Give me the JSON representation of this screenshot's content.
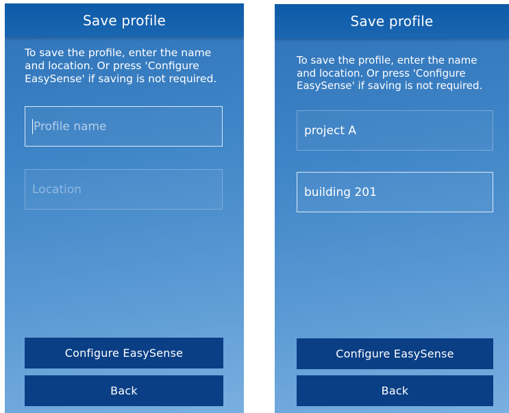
{
  "screens": [
    {
      "title": "Save profile",
      "instructions": "To save the profile, enter the name\nand location. Or press 'Configure\nEasySense' if saving is not required.",
      "profile_name": {
        "value": "",
        "placeholder": "Profile name"
      },
      "location": {
        "value": "",
        "placeholder": "Location"
      },
      "configure_label": "Configure EasySense",
      "back_label": "Back"
    },
    {
      "title": "Save profile",
      "instructions": "To save the profile, enter the name\nand location. Or press 'Configure\nEasySense' if saving is not required.",
      "profile_name": {
        "value": "project A",
        "placeholder": ""
      },
      "location": {
        "value": "building 201",
        "placeholder": ""
      },
      "configure_label": "Configure EasySense",
      "back_label": "Back"
    }
  ]
}
